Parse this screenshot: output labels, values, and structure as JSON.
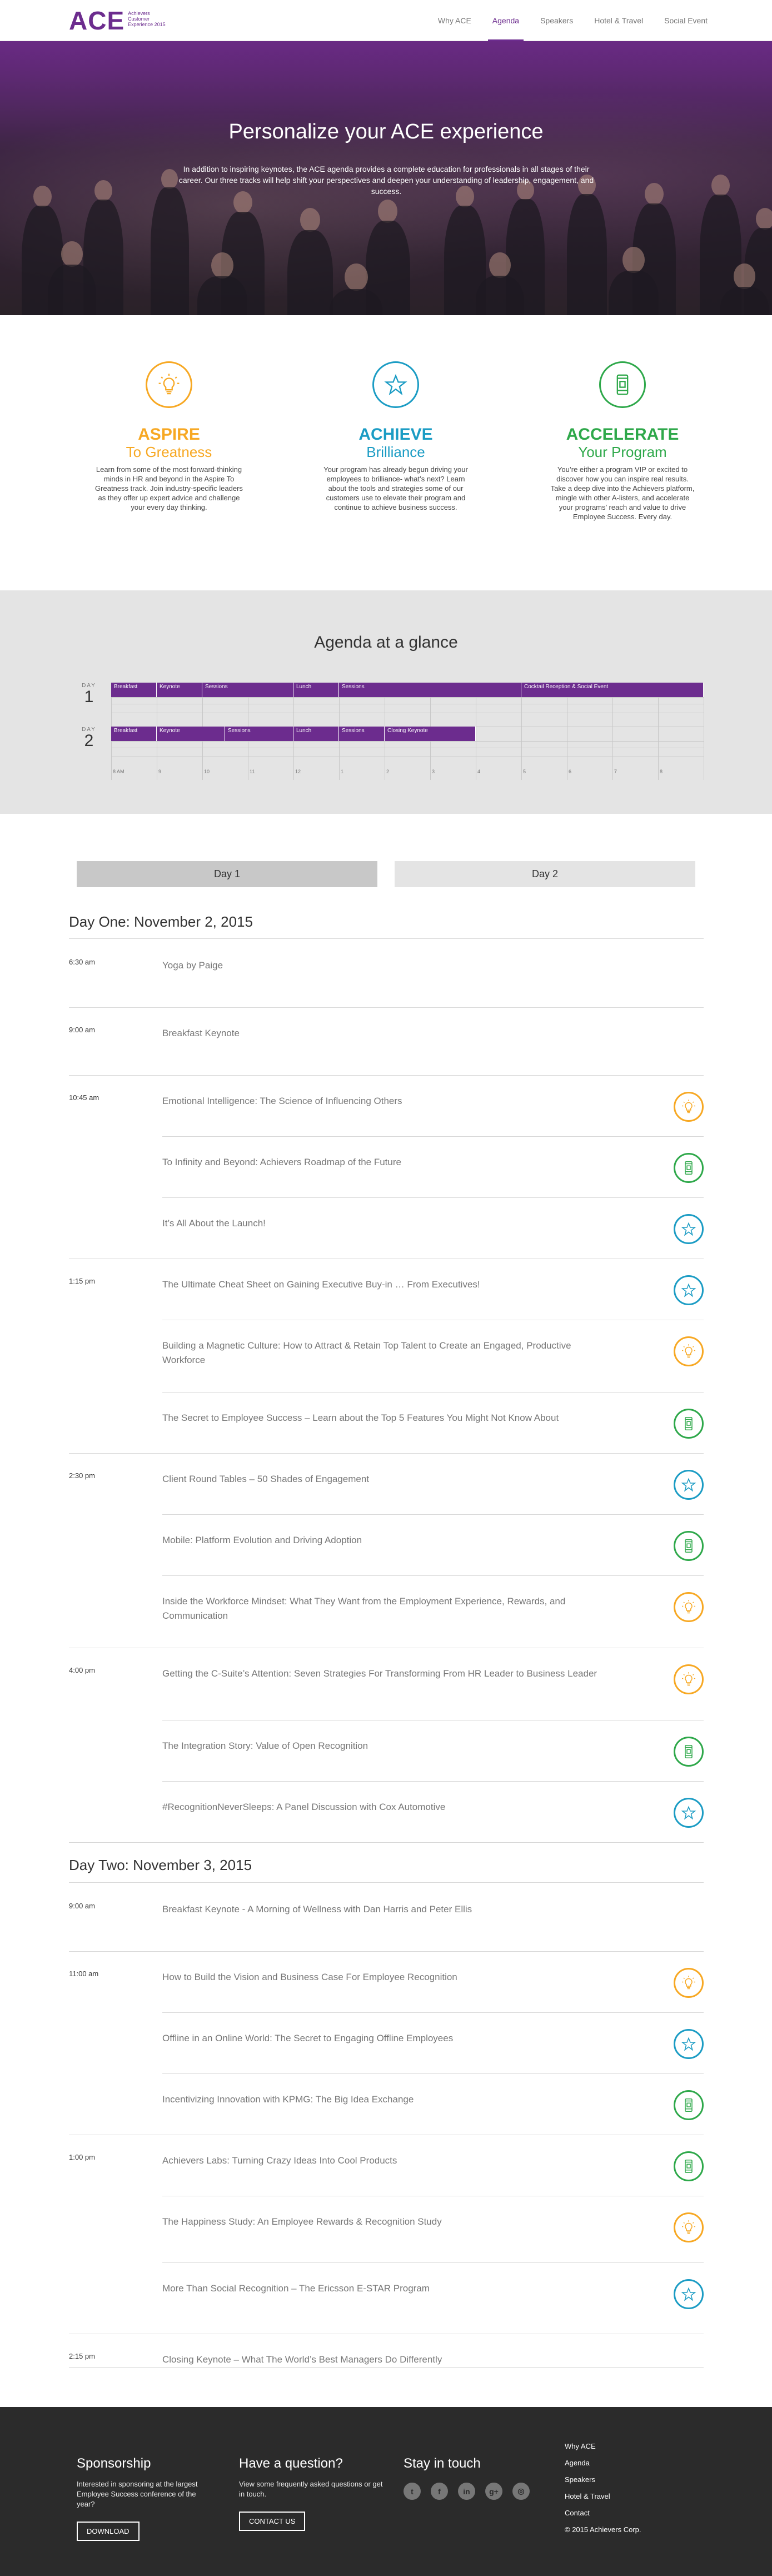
{
  "brand": {
    "logo_text": "ACE",
    "logo_sub": "Achievers Customer Experience 2015",
    "purple": "#6c2c8e",
    "orange": "#f7a823",
    "teal": "#1b9cc4",
    "green": "#2ea84a"
  },
  "nav": {
    "items": [
      {
        "label": "Why ACE",
        "active": false
      },
      {
        "label": "Agenda",
        "active": true
      },
      {
        "label": "Speakers",
        "active": false
      },
      {
        "label": "Hotel & Travel",
        "active": false
      },
      {
        "label": "Social Event",
        "active": false
      }
    ]
  },
  "hero": {
    "title": "Personalize your ACE experience",
    "text": "In addition to inspiring keynotes, the ACE agenda provides a complete education for professionals in all stages of their career. Our three tracks will help shift your perspectives and deepen your understanding of leadership, engagement, and success."
  },
  "tracks": [
    {
      "key": "aspire",
      "title": "ASPIRE",
      "sub": "To Greatness",
      "icon": "lightbulb-icon",
      "desc": "Learn from some of the most forward-thinking minds in HR and beyond in the Aspire To Greatness track. Join industry-specific leaders as they offer up expert advice and challenge your every day thinking."
    },
    {
      "key": "achieve",
      "title": "ACHIEVE",
      "sub": "Brilliance",
      "icon": "star-icon",
      "desc": "Your program has already begun driving your employees to brilliance- what’s next? Learn about the tools and strategies some of our customers use to elevate their program and continue to achieve business success."
    },
    {
      "key": "accelerate",
      "title": "ACCELERATE",
      "sub": "Your Program",
      "icon": "mobile-icon",
      "desc": "You’re either a program VIP or excited to discover how you can inspire real results. Take a deep dive into the Achievers platform, mingle with other A-listers, and accelerate your programs’ reach and value to drive Employee Success. Every day."
    }
  ],
  "glance": {
    "title": "Agenda at a glance",
    "day_word": "DAY",
    "days": [
      {
        "num": "1",
        "blocks": [
          {
            "label": "Breakfast",
            "start": 0,
            "end": 1
          },
          {
            "label": "Keynote",
            "start": 1,
            "end": 2
          },
          {
            "label": "Sessions",
            "start": 2,
            "end": 4
          },
          {
            "label": "Lunch",
            "start": 4,
            "end": 5
          },
          {
            "label": "Sessions",
            "start": 5,
            "end": 9
          },
          {
            "label": "Cocktail Reception & Social Event",
            "start": 9,
            "end": 13
          }
        ]
      },
      {
        "num": "2",
        "blocks": [
          {
            "label": "Breakfast",
            "start": 0,
            "end": 1
          },
          {
            "label": "Keynote",
            "start": 1,
            "end": 2.5
          },
          {
            "label": "Sessions",
            "start": 2.5,
            "end": 4
          },
          {
            "label": "Lunch",
            "start": 4,
            "end": 5
          },
          {
            "label": "Sessions",
            "start": 5,
            "end": 6
          },
          {
            "label": "Closing Keynote",
            "start": 6,
            "end": 8
          }
        ]
      }
    ],
    "ticks": [
      "8 AM",
      "9",
      "10",
      "11",
      "12",
      "1",
      "2",
      "3",
      "4",
      "5",
      "6",
      "7",
      "8"
    ]
  },
  "tabs": [
    {
      "label": "Day 1",
      "active": true
    },
    {
      "label": "Day 2",
      "active": false
    }
  ],
  "agenda": {
    "day1_title": "Day One: November 2, 2015",
    "day2_title": "Day Two: November 3, 2015",
    "day1": [
      {
        "time": "6:30 am",
        "sessions": [
          {
            "title": "Yoga by Paige",
            "track": ""
          }
        ]
      },
      {
        "time": "9:00 am",
        "sessions": [
          {
            "title": "Breakfast Keynote",
            "track": ""
          }
        ]
      },
      {
        "time": "10:45 am",
        "sessions": [
          {
            "title": "Emotional Intelligence: The Science of Influencing Others",
            "track": "aspire"
          },
          {
            "title": "To Infinity and Beyond: Achievers Roadmap of the Future",
            "track": "accelerate"
          },
          {
            "title": "It’s All About the Launch!",
            "track": "achieve"
          }
        ]
      },
      {
        "time": "1:15 pm",
        "sessions": [
          {
            "title": "The Ultimate Cheat Sheet on Gaining Executive Buy-in … From Executives!",
            "track": "achieve"
          },
          {
            "title": "Building a Magnetic Culture: How to Attract & Retain Top Talent to Create an Engaged, Productive Workforce",
            "track": "aspire"
          },
          {
            "title": "The Secret to Employee Success – Learn about the Top 5 Features You Might Not Know About",
            "track": "accelerate"
          }
        ]
      },
      {
        "time": "2:30 pm",
        "sessions": [
          {
            "title": "Client Round Tables – 50 Shades of Engagement",
            "track": "achieve"
          },
          {
            "title": "Mobile: Platform Evolution and Driving Adoption",
            "track": "accelerate"
          },
          {
            "title": "Inside the Workforce Mindset: What They Want from the Employment Experience, Rewards, and Communication",
            "track": "aspire"
          }
        ]
      },
      {
        "time": "4:00 pm",
        "sessions": [
          {
            "title": "Getting the C-Suite’s Attention: Seven Strategies For Transforming From HR Leader to Business Leader",
            "track": "aspire"
          },
          {
            "title": "The Integration Story: Value of Open Recognition",
            "track": "accelerate"
          },
          {
            "title": "#RecognitionNeverSleeps: A Panel Discussion with Cox Automotive",
            "track": "achieve"
          }
        ]
      }
    ],
    "day2": [
      {
        "time": "9:00 am",
        "sessions": [
          {
            "title": "Breakfast Keynote - A Morning of Wellness with Dan Harris and Peter Ellis",
            "track": ""
          }
        ]
      },
      {
        "time": "11:00 am",
        "sessions": [
          {
            "title": "How to Build the Vision and Business Case For Employee Recognition",
            "track": "aspire"
          },
          {
            "title": "Offline in an Online World: The Secret to Engaging Offline Employees",
            "track": "achieve"
          },
          {
            "title": "Incentivizing Innovation with KPMG: The Big Idea Exchange",
            "track": "accelerate"
          }
        ]
      },
      {
        "time": "1:00 pm",
        "sessions": [
          {
            "title": "Achievers Labs: Turning Crazy Ideas Into Cool Products",
            "track": "accelerate"
          },
          {
            "title": "The Happiness Study: An Employee Rewards & Recognition Study",
            "track": "aspire"
          },
          {
            "title": "More Than Social Recognition – The Ericsson E-STAR Program",
            "track": "achieve"
          }
        ]
      },
      {
        "time": "2:15 pm",
        "sessions": [
          {
            "title": "Closing Keynote – What The World’s Best Managers Do Differently",
            "track": ""
          }
        ]
      }
    ]
  },
  "footer": {
    "sponsor_title": "Sponsorship",
    "sponsor_text": "Interested in sponsoring at the largest Employee Success conference of the year?",
    "sponsor_btn": "DOWNLOAD",
    "question_title": "Have a question?",
    "question_text": "View some frequently asked questions or get in touch.",
    "question_btn": "CONTACT US",
    "stay_title": "Stay in touch",
    "social": [
      {
        "icon": "twitter-icon",
        "glyph": "t"
      },
      {
        "icon": "facebook-icon",
        "glyph": "f"
      },
      {
        "icon": "linkedin-icon",
        "glyph": "in"
      },
      {
        "icon": "googleplus-icon",
        "glyph": "g+"
      },
      {
        "icon": "instagram-icon",
        "glyph": "◎"
      }
    ],
    "links": [
      "Why ACE",
      "Agenda",
      "Speakers",
      "Hotel & Travel",
      "Contact"
    ],
    "copyright": "© 2015 Achievers Corp."
  }
}
